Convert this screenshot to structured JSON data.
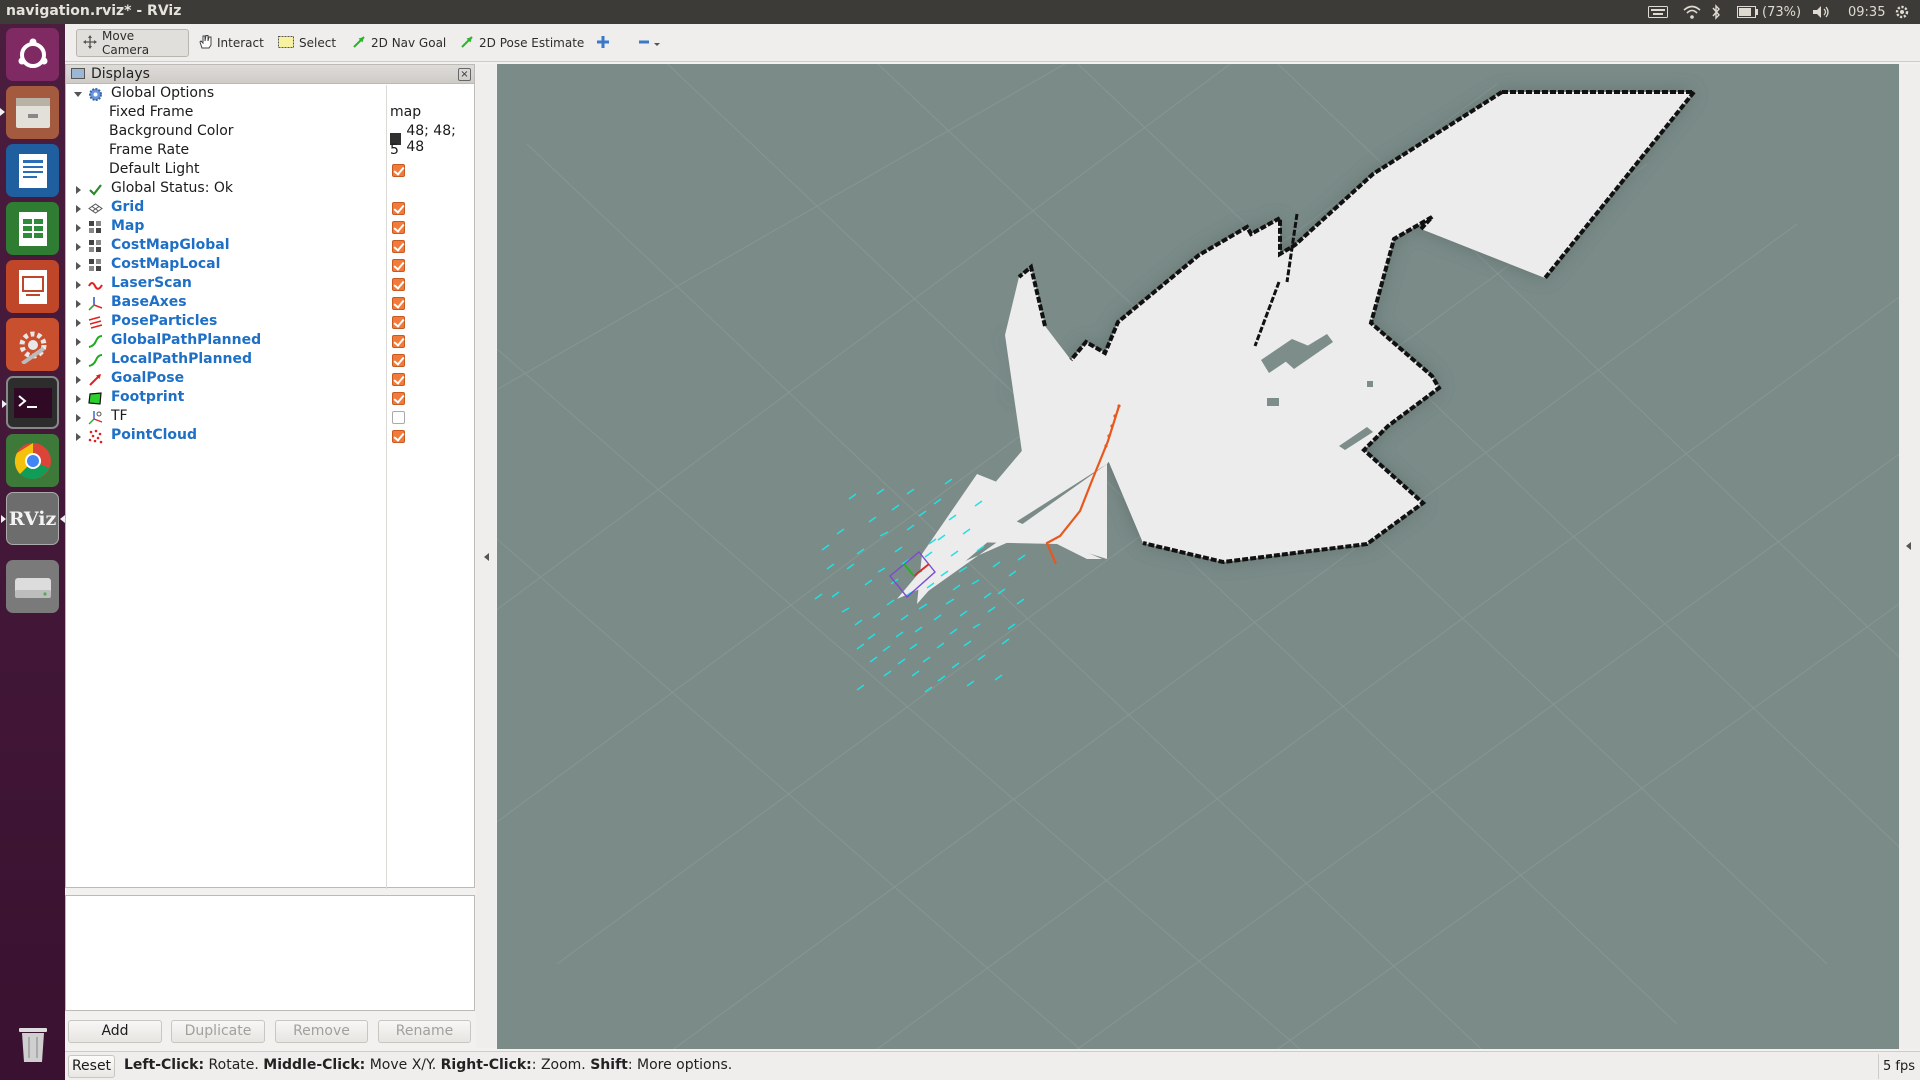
{
  "window": {
    "title": "navigation.rviz* - RViz"
  },
  "system": {
    "battery": "(73%)",
    "clock": "09:35"
  },
  "toolbar": {
    "move_camera": "Move Camera",
    "interact": "Interact",
    "select": "Select",
    "nav_goal": "2D Nav Goal",
    "pose_estimate": "2D Pose Estimate"
  },
  "displays": {
    "title": "Displays",
    "global_options": {
      "label": "Global Options",
      "fixed_frame_label": "Fixed Frame",
      "fixed_frame_value": "map",
      "bg_color_label": "Background Color",
      "bg_color_value": "48; 48; 48",
      "frame_rate_label": "Frame Rate",
      "frame_rate_value": "5",
      "default_light_label": "Default Light"
    },
    "global_status": "Global Status: Ok",
    "items": [
      {
        "label": "Grid",
        "checked": true
      },
      {
        "label": "Map",
        "checked": true
      },
      {
        "label": "CostMapGlobal",
        "checked": true
      },
      {
        "label": "CostMapLocal",
        "checked": true
      },
      {
        "label": "LaserScan",
        "checked": true
      },
      {
        "label": "BaseAxes",
        "checked": true
      },
      {
        "label": "PoseParticles",
        "checked": true
      },
      {
        "label": "GlobalPathPlanned",
        "checked": true
      },
      {
        "label": "LocalPathPlanned",
        "checked": true
      },
      {
        "label": "GoalPose",
        "checked": true
      },
      {
        "label": "Footprint",
        "checked": true
      },
      {
        "label": "TF",
        "checked": false
      },
      {
        "label": "PointCloud",
        "checked": true
      }
    ]
  },
  "panel_buttons": {
    "add": "Add",
    "duplicate": "Duplicate",
    "remove": "Remove",
    "rename": "Rename"
  },
  "status": {
    "reset": "Reset",
    "left_click_key": "Left-Click:",
    "left_click_text": " Rotate. ",
    "middle_click_key": "Middle-Click:",
    "middle_click_text": " Move X/Y. ",
    "right_click_key": "Right-Click:",
    "right_click_text": ": Zoom. ",
    "shift_key": "Shift",
    "shift_text": ": More options.",
    "fps": "5 fps"
  },
  "colors": {
    "viewport_bg": "#7a8b88",
    "map_free": "#ececec",
    "map_wall": "#000000",
    "particles": "#1de3e6",
    "global_path": "#e8581c",
    "checkbox": "#f27a3a",
    "launcher": "#4b1d3f"
  }
}
